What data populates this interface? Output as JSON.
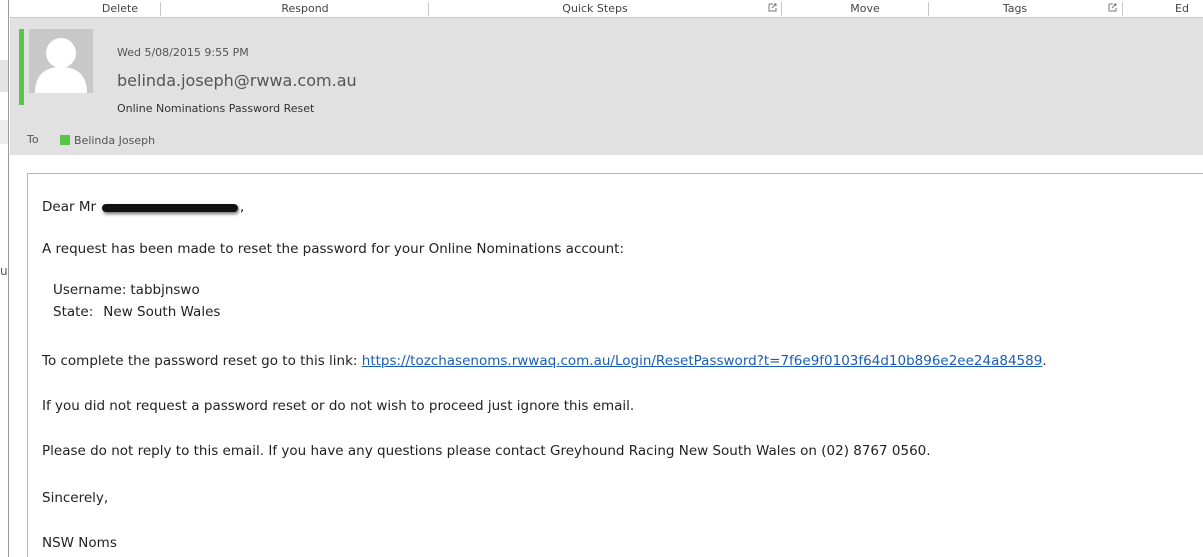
{
  "ribbon": {
    "groups": [
      {
        "name": "ribbon-group-delete",
        "label": "Delete"
      },
      {
        "name": "ribbon-group-respond",
        "label": "Respond"
      },
      {
        "name": "ribbon-group-quick-steps",
        "label": "Quick Steps"
      },
      {
        "name": "ribbon-group-move",
        "label": "Move"
      },
      {
        "name": "ribbon-group-tags",
        "label": "Tags"
      },
      {
        "name": "ribbon-group-editing",
        "label": "Ed"
      }
    ]
  },
  "left_pane": {
    "letter": "u"
  },
  "header": {
    "date": "Wed 5/08/2015 9:55 PM",
    "sender": "belinda.joseph@rwwa.com.au",
    "subject": "Online Nominations Password Reset",
    "to_label": "To",
    "to_recipient": "Belinda Joseph",
    "presence_color": "#58c546"
  },
  "body": {
    "greeting_prefix": "Dear Mr",
    "greeting_suffix": ",",
    "request_line": "A request has been made to reset the password for your Online Nominations account:",
    "username_label": "Username:",
    "username_value": "tabbjnswo",
    "state_label": "State:",
    "state_value": "New South Wales",
    "reset_prefix": "To complete the password reset go to this link: ",
    "reset_link": "https://tozchasenoms.rwwaq.com.au/Login/ResetPassword?t=7f6e9f0103f64d10b896e2ee24a84589",
    "reset_suffix": ".",
    "ignore_line": "If you did not request a password reset or do not wish to proceed just ignore this email.",
    "noreply_line": "Please do not reply to this email. If you have any questions please contact Greyhound Racing New South Wales on (02) 8767 0560.",
    "sincerely": "Sincerely,",
    "signoff": "NSW Noms"
  },
  "colors": {
    "accent_green": "#58c546",
    "link_blue": "#1a5fb4",
    "header_bg": "#e1e1e1"
  }
}
